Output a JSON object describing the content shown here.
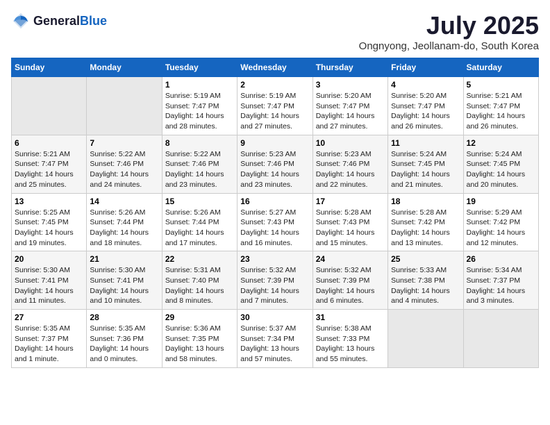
{
  "logo": {
    "general": "General",
    "blue": "Blue"
  },
  "title": "July 2025",
  "subtitle": "Ongnyong, Jeollanam-do, South Korea",
  "headers": [
    "Sunday",
    "Monday",
    "Tuesday",
    "Wednesday",
    "Thursday",
    "Friday",
    "Saturday"
  ],
  "weeks": [
    [
      {
        "day": "",
        "sunrise": "",
        "sunset": "",
        "daylight": ""
      },
      {
        "day": "",
        "sunrise": "",
        "sunset": "",
        "daylight": ""
      },
      {
        "day": "1",
        "sunrise": "Sunrise: 5:19 AM",
        "sunset": "Sunset: 7:47 PM",
        "daylight": "Daylight: 14 hours and 28 minutes."
      },
      {
        "day": "2",
        "sunrise": "Sunrise: 5:19 AM",
        "sunset": "Sunset: 7:47 PM",
        "daylight": "Daylight: 14 hours and 27 minutes."
      },
      {
        "day": "3",
        "sunrise": "Sunrise: 5:20 AM",
        "sunset": "Sunset: 7:47 PM",
        "daylight": "Daylight: 14 hours and 27 minutes."
      },
      {
        "day": "4",
        "sunrise": "Sunrise: 5:20 AM",
        "sunset": "Sunset: 7:47 PM",
        "daylight": "Daylight: 14 hours and 26 minutes."
      },
      {
        "day": "5",
        "sunrise": "Sunrise: 5:21 AM",
        "sunset": "Sunset: 7:47 PM",
        "daylight": "Daylight: 14 hours and 26 minutes."
      }
    ],
    [
      {
        "day": "6",
        "sunrise": "Sunrise: 5:21 AM",
        "sunset": "Sunset: 7:47 PM",
        "daylight": "Daylight: 14 hours and 25 minutes."
      },
      {
        "day": "7",
        "sunrise": "Sunrise: 5:22 AM",
        "sunset": "Sunset: 7:46 PM",
        "daylight": "Daylight: 14 hours and 24 minutes."
      },
      {
        "day": "8",
        "sunrise": "Sunrise: 5:22 AM",
        "sunset": "Sunset: 7:46 PM",
        "daylight": "Daylight: 14 hours and 23 minutes."
      },
      {
        "day": "9",
        "sunrise": "Sunrise: 5:23 AM",
        "sunset": "Sunset: 7:46 PM",
        "daylight": "Daylight: 14 hours and 23 minutes."
      },
      {
        "day": "10",
        "sunrise": "Sunrise: 5:23 AM",
        "sunset": "Sunset: 7:46 PM",
        "daylight": "Daylight: 14 hours and 22 minutes."
      },
      {
        "day": "11",
        "sunrise": "Sunrise: 5:24 AM",
        "sunset": "Sunset: 7:45 PM",
        "daylight": "Daylight: 14 hours and 21 minutes."
      },
      {
        "day": "12",
        "sunrise": "Sunrise: 5:24 AM",
        "sunset": "Sunset: 7:45 PM",
        "daylight": "Daylight: 14 hours and 20 minutes."
      }
    ],
    [
      {
        "day": "13",
        "sunrise": "Sunrise: 5:25 AM",
        "sunset": "Sunset: 7:45 PM",
        "daylight": "Daylight: 14 hours and 19 minutes."
      },
      {
        "day": "14",
        "sunrise": "Sunrise: 5:26 AM",
        "sunset": "Sunset: 7:44 PM",
        "daylight": "Daylight: 14 hours and 18 minutes."
      },
      {
        "day": "15",
        "sunrise": "Sunrise: 5:26 AM",
        "sunset": "Sunset: 7:44 PM",
        "daylight": "Daylight: 14 hours and 17 minutes."
      },
      {
        "day": "16",
        "sunrise": "Sunrise: 5:27 AM",
        "sunset": "Sunset: 7:43 PM",
        "daylight": "Daylight: 14 hours and 16 minutes."
      },
      {
        "day": "17",
        "sunrise": "Sunrise: 5:28 AM",
        "sunset": "Sunset: 7:43 PM",
        "daylight": "Daylight: 14 hours and 15 minutes."
      },
      {
        "day": "18",
        "sunrise": "Sunrise: 5:28 AM",
        "sunset": "Sunset: 7:42 PM",
        "daylight": "Daylight: 14 hours and 13 minutes."
      },
      {
        "day": "19",
        "sunrise": "Sunrise: 5:29 AM",
        "sunset": "Sunset: 7:42 PM",
        "daylight": "Daylight: 14 hours and 12 minutes."
      }
    ],
    [
      {
        "day": "20",
        "sunrise": "Sunrise: 5:30 AM",
        "sunset": "Sunset: 7:41 PM",
        "daylight": "Daylight: 14 hours and 11 minutes."
      },
      {
        "day": "21",
        "sunrise": "Sunrise: 5:30 AM",
        "sunset": "Sunset: 7:41 PM",
        "daylight": "Daylight: 14 hours and 10 minutes."
      },
      {
        "day": "22",
        "sunrise": "Sunrise: 5:31 AM",
        "sunset": "Sunset: 7:40 PM",
        "daylight": "Daylight: 14 hours and 8 minutes."
      },
      {
        "day": "23",
        "sunrise": "Sunrise: 5:32 AM",
        "sunset": "Sunset: 7:39 PM",
        "daylight": "Daylight: 14 hours and 7 minutes."
      },
      {
        "day": "24",
        "sunrise": "Sunrise: 5:32 AM",
        "sunset": "Sunset: 7:39 PM",
        "daylight": "Daylight: 14 hours and 6 minutes."
      },
      {
        "day": "25",
        "sunrise": "Sunrise: 5:33 AM",
        "sunset": "Sunset: 7:38 PM",
        "daylight": "Daylight: 14 hours and 4 minutes."
      },
      {
        "day": "26",
        "sunrise": "Sunrise: 5:34 AM",
        "sunset": "Sunset: 7:37 PM",
        "daylight": "Daylight: 14 hours and 3 minutes."
      }
    ],
    [
      {
        "day": "27",
        "sunrise": "Sunrise: 5:35 AM",
        "sunset": "Sunset: 7:37 PM",
        "daylight": "Daylight: 14 hours and 1 minute."
      },
      {
        "day": "28",
        "sunrise": "Sunrise: 5:35 AM",
        "sunset": "Sunset: 7:36 PM",
        "daylight": "Daylight: 14 hours and 0 minutes."
      },
      {
        "day": "29",
        "sunrise": "Sunrise: 5:36 AM",
        "sunset": "Sunset: 7:35 PM",
        "daylight": "Daylight: 13 hours and 58 minutes."
      },
      {
        "day": "30",
        "sunrise": "Sunrise: 5:37 AM",
        "sunset": "Sunset: 7:34 PM",
        "daylight": "Daylight: 13 hours and 57 minutes."
      },
      {
        "day": "31",
        "sunrise": "Sunrise: 5:38 AM",
        "sunset": "Sunset: 7:33 PM",
        "daylight": "Daylight: 13 hours and 55 minutes."
      },
      {
        "day": "",
        "sunrise": "",
        "sunset": "",
        "daylight": ""
      },
      {
        "day": "",
        "sunrise": "",
        "sunset": "",
        "daylight": ""
      }
    ]
  ]
}
